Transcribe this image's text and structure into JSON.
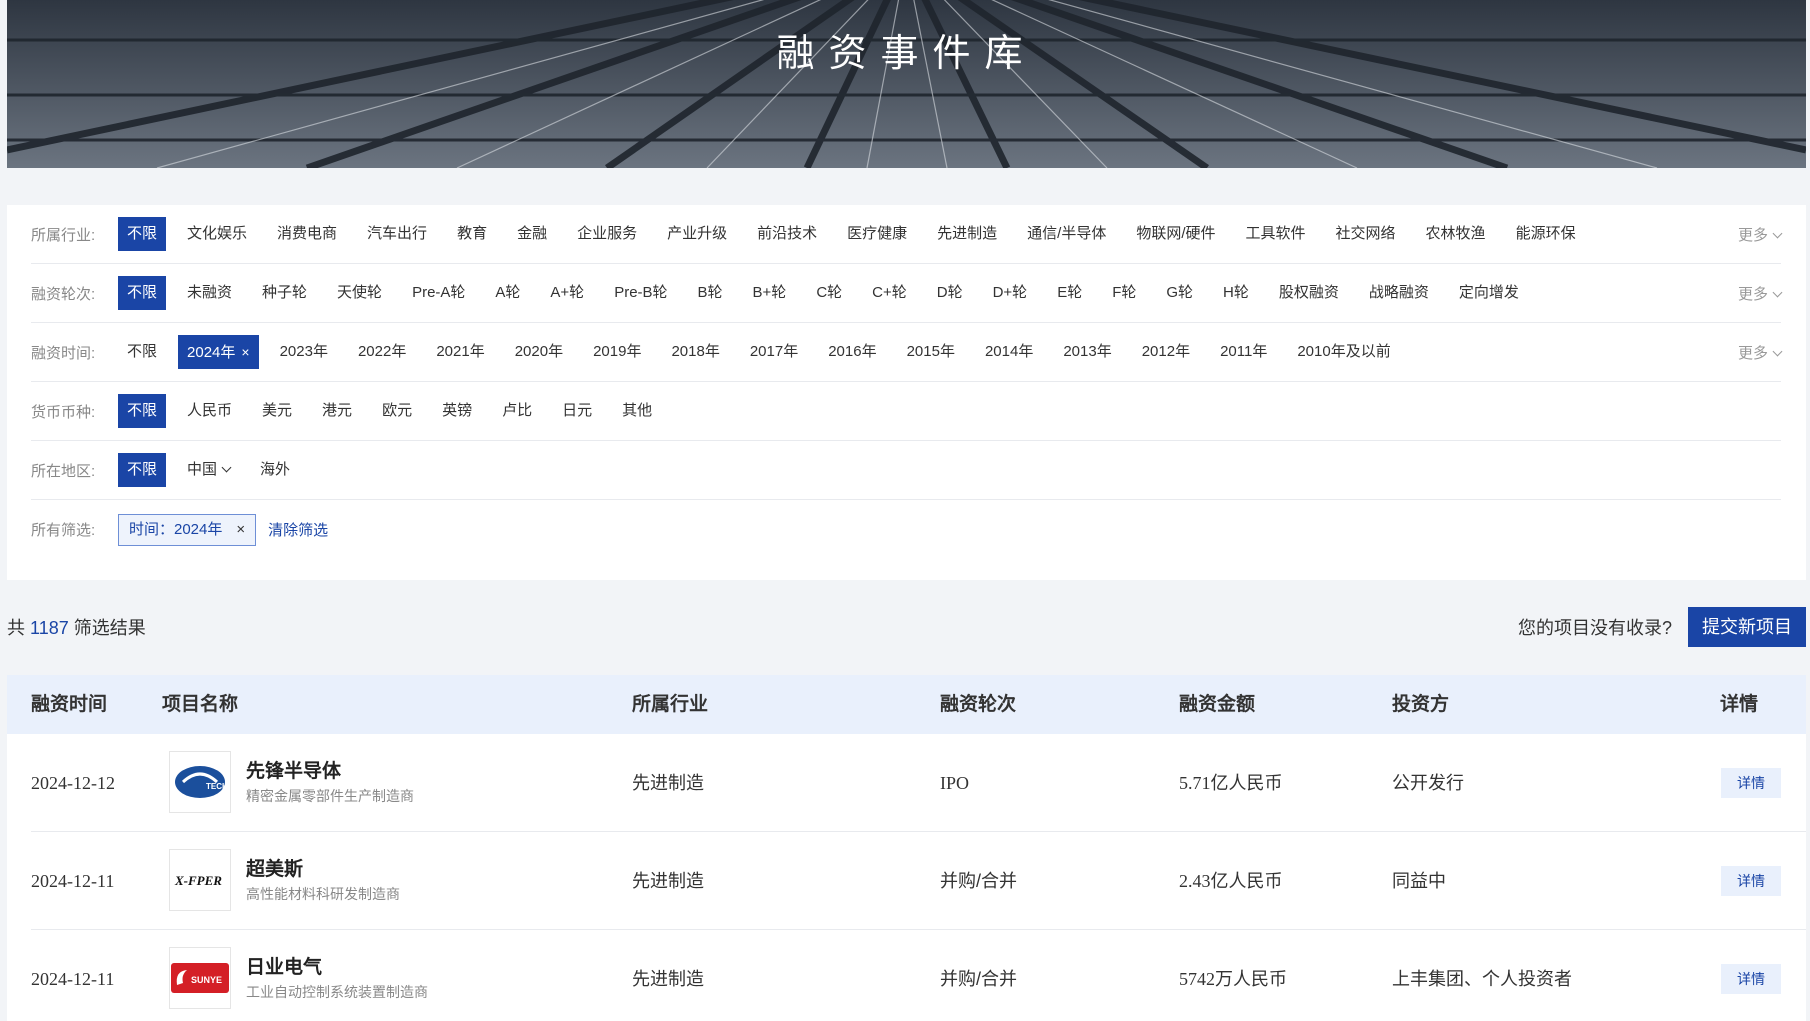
{
  "banner": {
    "title": "融资事件库"
  },
  "filters": {
    "industry": {
      "label": "所属行业:",
      "options": [
        "不限",
        "文化娱乐",
        "消费电商",
        "汽车出行",
        "教育",
        "金融",
        "企业服务",
        "产业升级",
        "前沿技术",
        "医疗健康",
        "先进制造",
        "通信/半导体",
        "物联网/硬件",
        "工具软件",
        "社交网络",
        "农林牧渔",
        "能源环保"
      ],
      "selected": 0,
      "more": "更多"
    },
    "round": {
      "label": "融资轮次:",
      "options": [
        "不限",
        "未融资",
        "种子轮",
        "天使轮",
        "Pre-A轮",
        "A轮",
        "A+轮",
        "Pre-B轮",
        "B轮",
        "B+轮",
        "C轮",
        "C+轮",
        "D轮",
        "D+轮",
        "E轮",
        "F轮",
        "G轮",
        "H轮",
        "股权融资",
        "战略融资",
        "定向增发"
      ],
      "selected": 0,
      "more": "更多"
    },
    "time": {
      "label": "融资时间:",
      "options": [
        "不限",
        "2024年",
        "2023年",
        "2022年",
        "2021年",
        "2020年",
        "2019年",
        "2018年",
        "2017年",
        "2016年",
        "2015年",
        "2014年",
        "2013年",
        "2012年",
        "2011年",
        "2010年及以前"
      ],
      "selected": 1,
      "more": "更多"
    },
    "currency": {
      "label": "货币币种:",
      "options": [
        "不限",
        "人民币",
        "美元",
        "港元",
        "欧元",
        "英镑",
        "卢比",
        "日元",
        "其他"
      ],
      "selected": 0
    },
    "region": {
      "label": "所在地区:",
      "options": [
        "不限",
        "中国",
        "海外"
      ],
      "selected": 0
    },
    "all": {
      "label": "所有筛选:",
      "chip": "时间：2024年",
      "clear": "清除筛选"
    }
  },
  "results": {
    "prefix": "共",
    "count": "1187",
    "suffix": "筛选结果",
    "ask": "您的项目没有收录?",
    "submit": "提交新项目"
  },
  "table": {
    "headers": [
      "融资时间",
      "项目名称",
      "所属行业",
      "融资轮次",
      "融资金额",
      "投资方",
      "详情"
    ],
    "rows": [
      {
        "date": "2024-12-12",
        "name": "先锋半导体",
        "desc": "精密金属零部件生产制造商",
        "industry": "先进制造",
        "round": "IPO",
        "amount": "5.71亿人民币",
        "investor": "公开发行",
        "detail": "详情",
        "logo": "TECH"
      },
      {
        "date": "2024-12-11",
        "name": "超美斯",
        "desc": "高性能材料科研发制造商",
        "industry": "先进制造",
        "round": "并购/合并",
        "amount": "2.43亿人民币",
        "investor": "同益中",
        "detail": "详情",
        "logo": "X-FPER"
      },
      {
        "date": "2024-12-11",
        "name": "日业电气",
        "desc": "工业自动控制系统装置制造商",
        "industry": "先进制造",
        "round": "并购/合并",
        "amount": "5742万人民币",
        "investor": "上丰集团、个人投资者",
        "detail": "详情",
        "logo": "SUNYE"
      }
    ]
  },
  "colors": {
    "primary": "#1a45a6",
    "header_bg": "#e9f0fc",
    "page_bg": "#f2f4f7"
  }
}
